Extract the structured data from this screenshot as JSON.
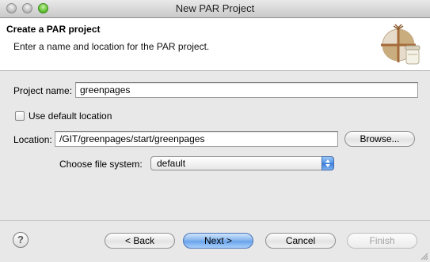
{
  "window": {
    "title": "New PAR Project"
  },
  "banner": {
    "title": "Create a PAR project",
    "description": "Enter a name and location for the PAR project.",
    "icon": "par-project-wizard-icon"
  },
  "form": {
    "project_name_label": "Project name:",
    "project_name_value": "greenpages",
    "use_default_location_label": "Use default location",
    "use_default_location_checked": false,
    "location_label": "Location:",
    "location_value": "/GIT/greenpages/start/greenpages",
    "browse_label": "Browse...",
    "file_system_label": "Choose file system:",
    "file_system_value": "default"
  },
  "footer": {
    "help_icon": "question-mark",
    "back_label": "< Back",
    "next_label": "Next >",
    "cancel_label": "Cancel",
    "finish_label": "Finish"
  },
  "colors": {
    "default_button": "#6aa3ec",
    "banner_background": "#ffffff",
    "dialog_background": "#e8e8e8"
  }
}
